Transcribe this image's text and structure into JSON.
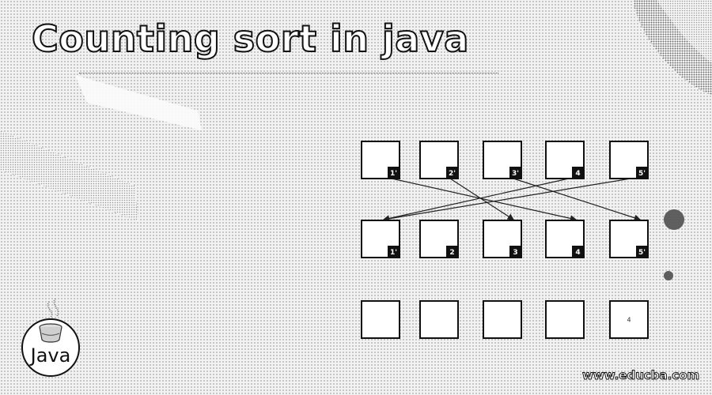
{
  "title": "Counting sort in java",
  "watermark": "www.educba.com",
  "logo": {
    "text": "Java",
    "icon": "java-cup-icon"
  },
  "rows": [
    {
      "name": "input-row",
      "cells": [
        {
          "value": "",
          "tag": "1'"
        },
        {
          "value": "",
          "tag": "2'"
        },
        {
          "value": "",
          "tag": "3'"
        },
        {
          "value": "",
          "tag": "4"
        },
        {
          "value": "",
          "tag": "5'"
        }
      ]
    },
    {
      "name": "sorted-row",
      "cells": [
        {
          "value": "",
          "tag": "1'"
        },
        {
          "value": "",
          "tag": "2"
        },
        {
          "value": "",
          "tag": "3"
        },
        {
          "value": "",
          "tag": "4"
        },
        {
          "value": "",
          "tag": "5'"
        }
      ]
    },
    {
      "name": "output-row",
      "cells": [
        {
          "value": "",
          "tag": ""
        },
        {
          "value": "",
          "tag": ""
        },
        {
          "value": "",
          "tag": ""
        },
        {
          "value": "",
          "tag": ""
        },
        {
          "value": "4",
          "tag": ""
        }
      ]
    }
  ],
  "arrows": [
    {
      "from": 0,
      "to": 3
    },
    {
      "from": 1,
      "to": 2
    },
    {
      "from": 2,
      "to": 4
    },
    {
      "from": 3,
      "to": 0
    },
    {
      "from": 4,
      "to": 0
    }
  ],
  "colors": {
    "box_stroke": "#111111",
    "tag_fill": "#111111",
    "tag_text": "#ffffff",
    "arrow": "#222222"
  }
}
